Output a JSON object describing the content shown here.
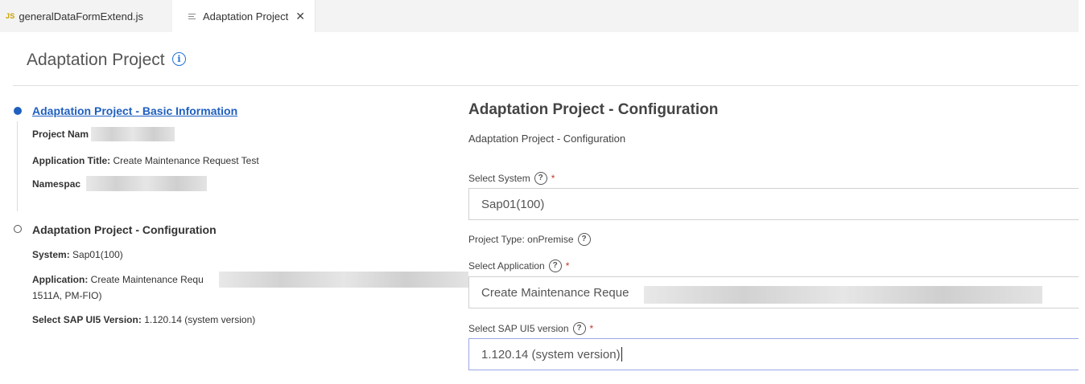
{
  "tabs": [
    {
      "icon": "JS",
      "label": "generalDataFormExtend.js"
    },
    {
      "icon": "preview-icon",
      "label": "Adaptation Project",
      "close": "✕"
    }
  ],
  "header": {
    "title": "Adaptation Project",
    "info_icon": "i"
  },
  "steps": [
    {
      "title": "Adaptation Project - Basic Information",
      "status": "active",
      "fields": [
        {
          "label": "Project Nam",
          "value": ""
        },
        {
          "label": "Application Title:",
          "value": "Create Maintenance Request Test"
        },
        {
          "label": "Namespac",
          "value": ""
        }
      ]
    },
    {
      "title": "Adaptation Project - Configuration",
      "status": "pending",
      "fields": [
        {
          "label": "System:",
          "value": "Sap01(100)"
        },
        {
          "label": "Application:",
          "value": "Create Maintenance Requ",
          "value_line2": "1511A, PM-FIO)"
        },
        {
          "label": "Select SAP UI5 Version:",
          "value": "1.120.14 (system version)"
        }
      ]
    }
  ],
  "form": {
    "title": "Adaptation Project - Configuration",
    "subtitle": "Adaptation Project - Configuration",
    "help_glyph": "?",
    "required_mark": "*",
    "select_system": {
      "label": "Select System",
      "value": "Sap01(100)"
    },
    "project_type": {
      "label": "Project Type: onPremise"
    },
    "select_application": {
      "label": "Select Application",
      "value": "Create Maintenance Reque"
    },
    "select_ui5": {
      "label": "Select SAP UI5 version",
      "value": "1.120.14 (system version)"
    }
  }
}
